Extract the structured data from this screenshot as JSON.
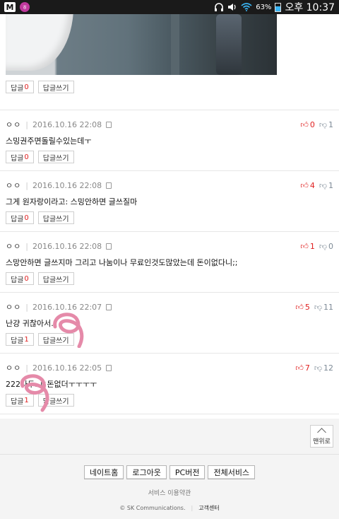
{
  "status_bar": {
    "app_icon_1": "M",
    "app_icon_2": "ㅎ",
    "battery": "63%",
    "time": "오후 10:37"
  },
  "first_comment_actions": {
    "reply_label": "답글",
    "reply_count": "0",
    "write_reply_label": "답글쓰기"
  },
  "comments": [
    {
      "nick": "ㅇㅇ",
      "date": "2016.10.16 22:08",
      "text": "스밍권주면돌릴수있는데ㅜ",
      "up": "0",
      "down": "1",
      "reply_label": "답글",
      "reply_count": "0",
      "write_reply_label": "답글쓰기"
    },
    {
      "nick": "ㅇㅇ",
      "date": "2016.10.16 22:08",
      "text": "그게 원자랑이라고: 스밍안하면 글쓰질마",
      "up": "4",
      "down": "1",
      "reply_label": "답글",
      "reply_count": "0",
      "write_reply_label": "답글쓰기"
    },
    {
      "nick": "ㅇㅇ",
      "date": "2016.10.16 22:08",
      "text": "스망안하면 글쓰지마 그리고 나눔이나 무료인것도많았는데 돈이없다니;;",
      "up": "1",
      "down": "0",
      "reply_label": "답글",
      "reply_count": "0",
      "write_reply_label": "답글쓰기"
    },
    {
      "nick": "ㅇㅇ",
      "date": "2016.10.16 22:07",
      "text": "난걍 귀찮아서..",
      "up": "5",
      "down": "11",
      "reply_label": "답글",
      "reply_count": "1",
      "write_reply_label": "답글쓰기"
    },
    {
      "nick": "ㅇㅇ",
      "date": "2016.10.16 22:05",
      "text": "222나두..ㄷ돈없더ㅜㅜㅜㅜ",
      "up": "7",
      "down": "12",
      "reply_label": "답글",
      "reply_count": "1",
      "write_reply_label": "답글쓰기"
    }
  ],
  "footer": {
    "top_button": "맨위로",
    "nav": [
      "네이트홈",
      "로그아웃",
      "PC버전",
      "전체서비스"
    ],
    "terms": "서비스 이용약관",
    "copyright": "© SK Communications.",
    "customer_center": "고객센터"
  },
  "colors": {
    "accent_red": "#e02020",
    "scribble_pink": "#e58aa9"
  }
}
